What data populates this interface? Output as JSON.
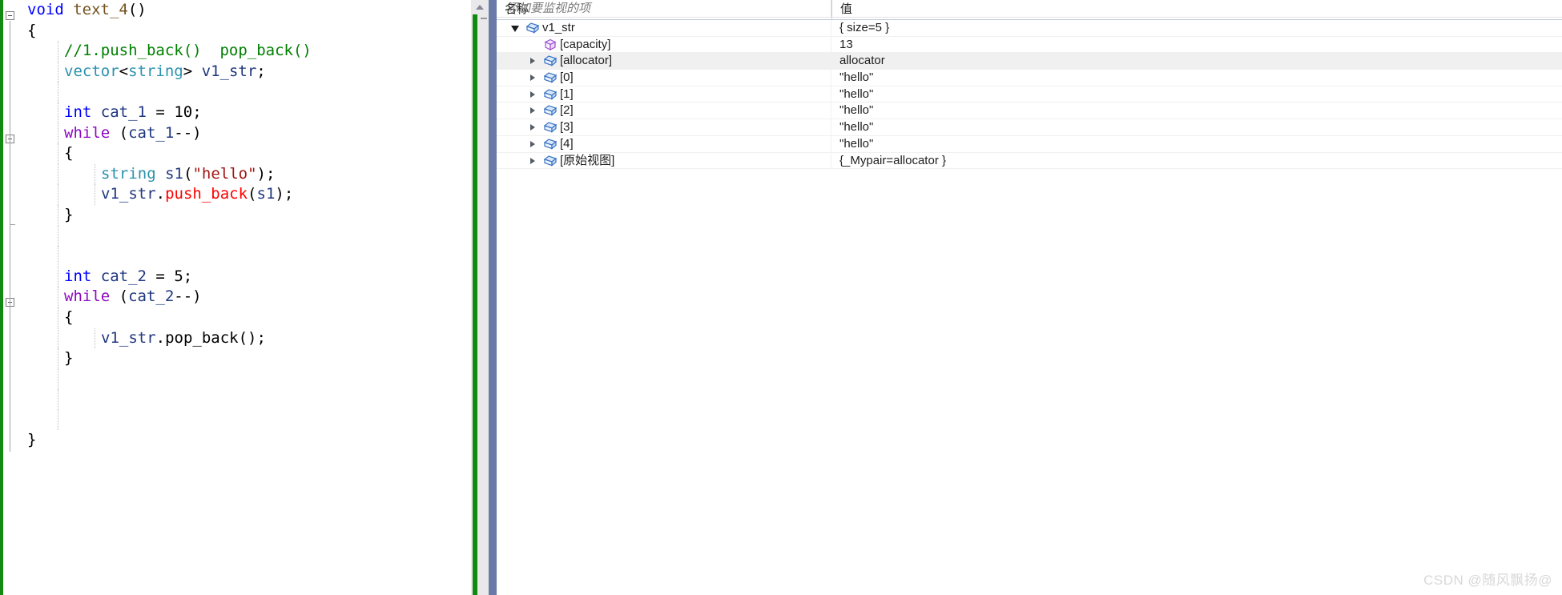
{
  "editor": {
    "language": "cpp",
    "change_bar_color": "#12890f",
    "lines": [
      {
        "indent": 0,
        "outline": "collapse",
        "tokens": [
          {
            "t": "void",
            "c": "kw"
          },
          {
            "t": " ",
            "c": "plain"
          },
          {
            "t": "text_4",
            "c": "fn"
          },
          {
            "t": "()",
            "c": "plain"
          }
        ]
      },
      {
        "indent": 0,
        "tokens": [
          {
            "t": "{",
            "c": "plain"
          }
        ]
      },
      {
        "indent": 1,
        "tokens": [
          {
            "t": "//1.push_back()  pop_back()",
            "c": "cmt"
          }
        ]
      },
      {
        "indent": 1,
        "tokens": [
          {
            "t": "vector",
            "c": "type"
          },
          {
            "t": "<",
            "c": "plain"
          },
          {
            "t": "string",
            "c": "type"
          },
          {
            "t": "> ",
            "c": "plain"
          },
          {
            "t": "v1_str",
            "c": "var"
          },
          {
            "t": ";",
            "c": "plain"
          }
        ]
      },
      {
        "indent": 1,
        "tokens": [
          {
            "t": "",
            "c": "plain"
          }
        ]
      },
      {
        "indent": 1,
        "tokens": [
          {
            "t": "int",
            "c": "kw"
          },
          {
            "t": " ",
            "c": "plain"
          },
          {
            "t": "cat_1",
            "c": "var"
          },
          {
            "t": " = ",
            "c": "plain"
          },
          {
            "t": "10",
            "c": "plain"
          },
          {
            "t": ";",
            "c": "plain"
          }
        ]
      },
      {
        "indent": 1,
        "outline": "collapse",
        "tokens": [
          {
            "t": "while",
            "c": "kwc"
          },
          {
            "t": " (",
            "c": "plain"
          },
          {
            "t": "cat_1",
            "c": "var"
          },
          {
            "t": "--)",
            "c": "plain"
          }
        ]
      },
      {
        "indent": 1,
        "tokens": [
          {
            "t": "{",
            "c": "plain"
          }
        ]
      },
      {
        "indent": 2,
        "tokens": [
          {
            "t": "string",
            "c": "type"
          },
          {
            "t": " ",
            "c": "plain"
          },
          {
            "t": "s1",
            "c": "var"
          },
          {
            "t": "(",
            "c": "plain"
          },
          {
            "t": "\"hello\"",
            "c": "str"
          },
          {
            "t": ");",
            "c": "plain"
          }
        ]
      },
      {
        "indent": 2,
        "tokens": [
          {
            "t": "v1_str",
            "c": "var"
          },
          {
            "t": ".",
            "c": "plain"
          },
          {
            "t": "push_back",
            "c": "mem"
          },
          {
            "t": "(",
            "c": "plain"
          },
          {
            "t": "s1",
            "c": "var"
          },
          {
            "t": ");",
            "c": "plain"
          }
        ]
      },
      {
        "indent": 1,
        "outline": "end",
        "tokens": [
          {
            "t": "}",
            "c": "plain"
          }
        ]
      },
      {
        "indent": 1,
        "tokens": [
          {
            "t": "",
            "c": "plain"
          }
        ]
      },
      {
        "indent": 1,
        "tokens": [
          {
            "t": "",
            "c": "plain"
          }
        ]
      },
      {
        "indent": 1,
        "tokens": [
          {
            "t": "int",
            "c": "kw"
          },
          {
            "t": " ",
            "c": "plain"
          },
          {
            "t": "cat_2",
            "c": "var"
          },
          {
            "t": " = ",
            "c": "plain"
          },
          {
            "t": "5",
            "c": "plain"
          },
          {
            "t": ";",
            "c": "plain"
          }
        ]
      },
      {
        "indent": 1,
        "outline": "collapse",
        "tokens": [
          {
            "t": "while",
            "c": "kwc"
          },
          {
            "t": " (",
            "c": "plain"
          },
          {
            "t": "cat_2",
            "c": "var"
          },
          {
            "t": "--)",
            "c": "plain"
          }
        ]
      },
      {
        "indent": 1,
        "tokens": [
          {
            "t": "{",
            "c": "plain"
          }
        ]
      },
      {
        "indent": 2,
        "tokens": [
          {
            "t": "v1_str",
            "c": "var"
          },
          {
            "t": ".",
            "c": "plain"
          },
          {
            "t": "pop_back",
            "c": "plain"
          },
          {
            "t": "();",
            "c": "plain"
          }
        ]
      },
      {
        "indent": 1,
        "tokens": [
          {
            "t": "}",
            "c": "plain"
          }
        ]
      },
      {
        "indent": 1,
        "tokens": [
          {
            "t": "",
            "c": "plain"
          }
        ]
      },
      {
        "indent": 1,
        "tokens": [
          {
            "t": "",
            "c": "plain"
          }
        ]
      },
      {
        "indent": 1,
        "tokens": [
          {
            "t": "",
            "c": "plain"
          }
        ]
      },
      {
        "indent": 0,
        "tokens": [
          {
            "t": "}",
            "c": "plain"
          }
        ]
      }
    ]
  },
  "scrollbar": {
    "up_arrow_icon": "scroll-up-arrow-icon",
    "track_color": "#12890f",
    "background": "#e9e9ec"
  },
  "watch_panel": {
    "columns": {
      "name": "名称",
      "value": "值"
    },
    "rows": [
      {
        "depth": 0,
        "expander": "down",
        "icon": "struct-icon",
        "name": "v1_str",
        "value": "{ size=5 }",
        "selected": false
      },
      {
        "depth": 1,
        "expander": "none",
        "icon": "field-icon",
        "name": "[capacity]",
        "value": "13",
        "selected": false
      },
      {
        "depth": 1,
        "expander": "right",
        "icon": "struct-icon",
        "name": "[allocator]",
        "value": "allocator",
        "selected": true
      },
      {
        "depth": 1,
        "expander": "right",
        "icon": "struct-icon",
        "name": "[0]",
        "value": "\"hello\"",
        "selected": false
      },
      {
        "depth": 1,
        "expander": "right",
        "icon": "struct-icon",
        "name": "[1]",
        "value": "\"hello\"",
        "selected": false
      },
      {
        "depth": 1,
        "expander": "right",
        "icon": "struct-icon",
        "name": "[2]",
        "value": "\"hello\"",
        "selected": false
      },
      {
        "depth": 1,
        "expander": "right",
        "icon": "struct-icon",
        "name": "[3]",
        "value": "\"hello\"",
        "selected": false
      },
      {
        "depth": 1,
        "expander": "right",
        "icon": "struct-icon",
        "name": "[4]",
        "value": "\"hello\"",
        "selected": false
      },
      {
        "depth": 1,
        "expander": "right",
        "icon": "struct-icon",
        "name": "[原始视图]",
        "value": "{_Mypair=allocator }",
        "selected": false
      }
    ],
    "add_watch_placeholder": "添加要监视的项"
  },
  "watermark": {
    "text": "CSDN @随风飘扬@"
  }
}
